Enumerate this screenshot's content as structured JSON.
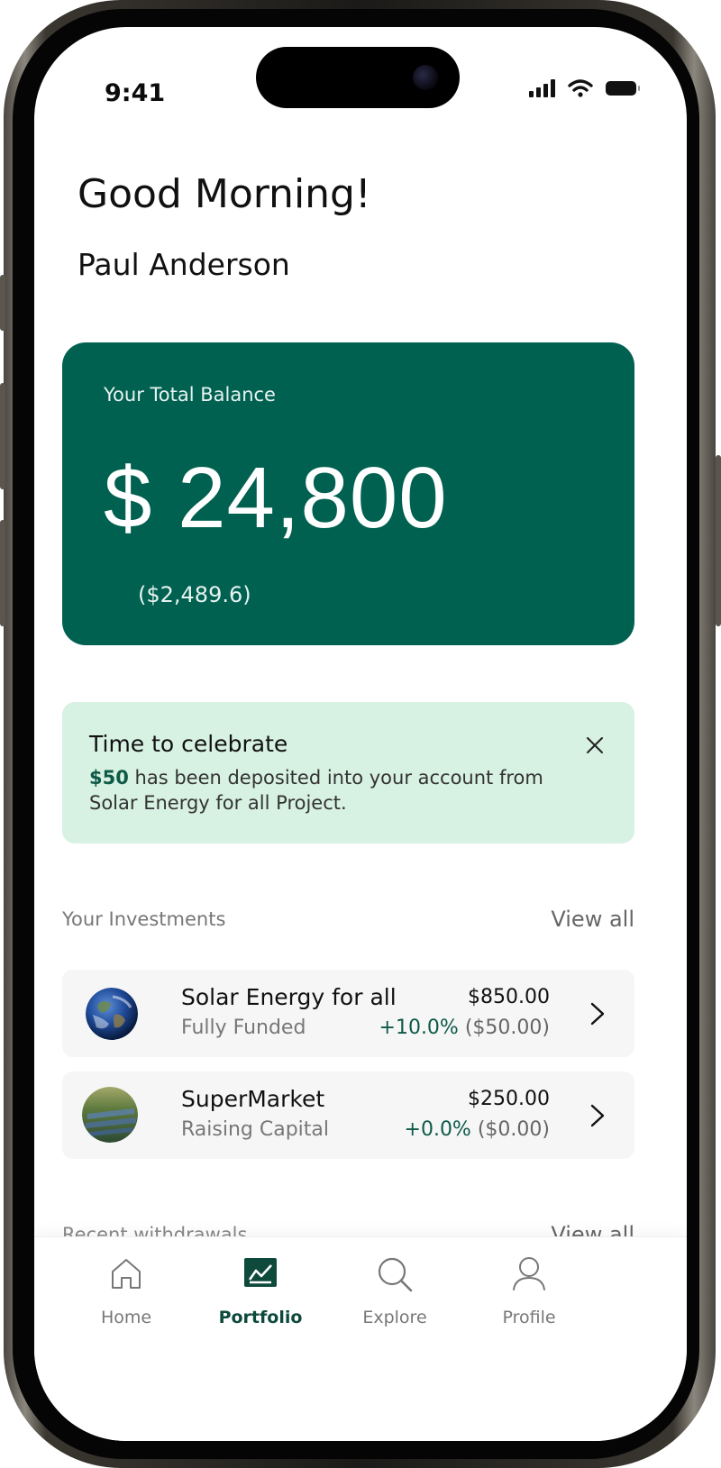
{
  "status_bar": {
    "time": "9:41"
  },
  "header": {
    "greeting": "Good Morning!",
    "user_name": "Paul Anderson"
  },
  "balance": {
    "label": "Your Total Balance",
    "amount": "$ 24,800",
    "change": "($2,489.6)"
  },
  "notice": {
    "title": "Time to celebrate",
    "amount": "$50",
    "message": " has been deposited into your account from Solar Energy for all Project."
  },
  "investments": {
    "title": "Your Investments",
    "view_all": "View all",
    "items": [
      {
        "name": "Solar Energy for all",
        "status": "Fully Funded",
        "value": "$850.00",
        "change_pct": "+10.0%",
        "change_amt": "($50.00)",
        "icon": "earth-image"
      },
      {
        "name": "SuperMarket",
        "status": "Raising Capital",
        "value": "$250.00",
        "change_pct": "+0.0%",
        "change_amt": "($0.00)",
        "icon": "solar-farm-image"
      }
    ]
  },
  "withdrawals": {
    "title": "Recent withdrawals",
    "view_all": "View all"
  },
  "tabs": [
    {
      "label": "Home",
      "icon": "home-icon",
      "active": false
    },
    {
      "label": "Portfolio",
      "icon": "chart-icon",
      "active": true
    },
    {
      "label": "Explore",
      "icon": "search-icon",
      "active": false
    },
    {
      "label": "Profile",
      "icon": "user-icon",
      "active": false
    }
  ],
  "colors": {
    "brand": "#006151",
    "notice_bg": "#d7f1e3",
    "positive": "#0e5a47"
  }
}
